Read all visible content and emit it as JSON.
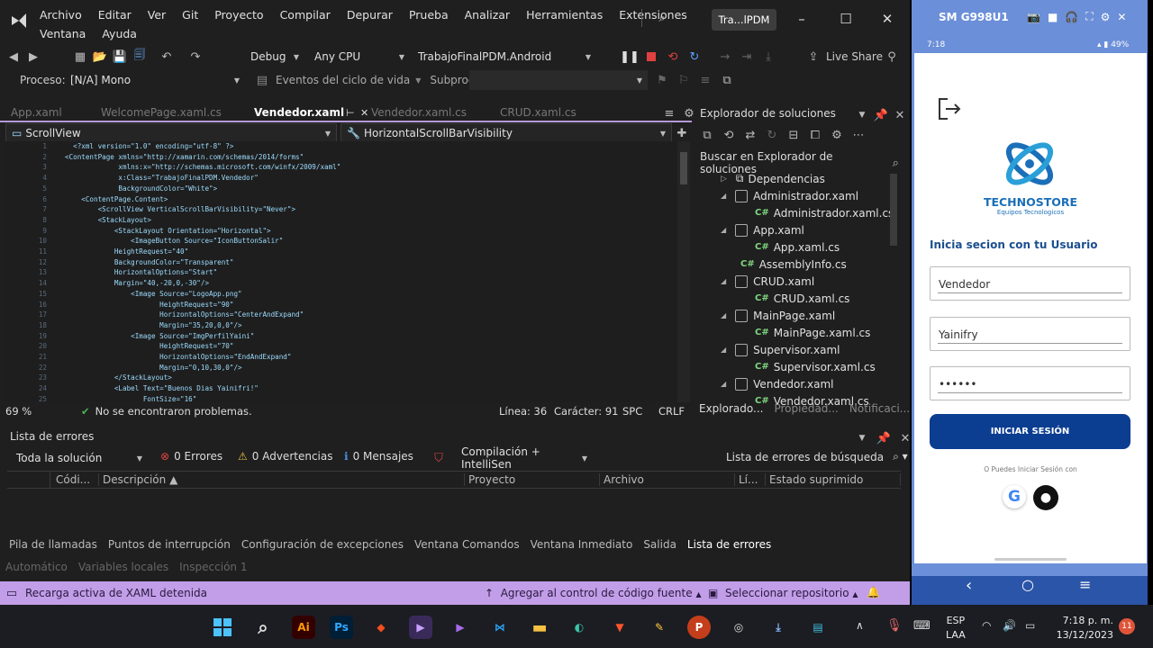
{
  "menu": [
    "Archivo",
    "Editar",
    "Ver",
    "Git",
    "Proyecto",
    "Compilar",
    "Depurar",
    "Prueba",
    "Analizar",
    "Herramientas",
    "Extensiones"
  ],
  "menu2": [
    "Ventana",
    "Ayuda"
  ],
  "window_title": "Tra...lPDM",
  "toolbar": {
    "config": "Debug",
    "platform": "Any CPU",
    "project": "TrabajoFinalPDM.Android",
    "live_share": "Live Share"
  },
  "process_bar": {
    "label": "Proceso:",
    "process": "[N/A] Mono",
    "lifecycle": "Eventos del ciclo de vida",
    "subprocess": "Subproceso:"
  },
  "doc_tabs": [
    "App.xaml",
    "WelcomePage.xaml.cs",
    "Vendedor.xaml",
    "Vendedor.xaml.cs",
    "CRUD.xaml.cs"
  ],
  "nav_left": "ScrollView",
  "nav_right": "HorizontalScrollBarVisibility",
  "code_lines": [
    "  <?xml version=\"1.0\" encoding=\"utf-8\" ?>",
    "<ContentPage xmlns=\"http://xamarin.com/schemas/2014/forms\"",
    "             xmlns:x=\"http://schemas.microsoft.com/winfx/2009/xaml\"",
    "             x:Class=\"TrabajoFinalPDM.Vendedor\"",
    "             BackgroundColor=\"White\">",
    "    <ContentPage.Content>",
    "        <ScrollView VerticalScrollBarVisibility=\"Never\">",
    "        <StackLayout>",
    "            <StackLayout Orientation=\"Horizontal\">",
    "                <ImageButton Source=\"IconButtonSalir\"",
    "            HeightRequest=\"40\"",
    "            BackgroundColor=\"Transparent\"",
    "            HorizontalOptions=\"Start\"",
    "            Margin=\"40,-20,0,-30\"/>",
    "                <Image Source=\"LogoApp.png\"",
    "                       HeightRequest=\"90\"",
    "                       HorizontalOptions=\"CenterAndExpand\"",
    "                       Margin=\"35,20,0,0\"/>",
    "                <Image Source=\"ImgPerfilYaini\"",
    "                       HeightRequest=\"70\"",
    "                       HorizontalOptions=\"EndAndExpand\"",
    "                       Margin=\"0,10,30,0\"/>",
    "            </StackLayout>",
    "            <Label Text=\"Buenos Dias Yainifri!\"",
    "                   FontSize=\"16\""
  ],
  "line_numbers": [
    "1",
    "2",
    "3",
    "4",
    "5",
    "6",
    "7",
    "8",
    "9",
    "10",
    "11",
    "12",
    "13",
    "14",
    "15",
    "16",
    "17",
    "18",
    "19",
    "20",
    "21",
    "22",
    "23",
    "24",
    "25"
  ],
  "editor_status": {
    "zoom": "69 %",
    "problems": "No se encontraron problemas.",
    "line": "Línea: 36",
    "char": "Carácter: 91",
    "spc": "SPC",
    "crlf": "CRLF"
  },
  "solution_explorer": {
    "title": "Explorador de soluciones",
    "search": "Buscar en Explorador de soluciones",
    "items": [
      {
        "label": "Dependencias",
        "kind": "dep"
      },
      {
        "label": "Administrador.xaml",
        "kind": "xaml"
      },
      {
        "label": "Administrador.xaml.cs",
        "kind": "cs"
      },
      {
        "label": "App.xaml",
        "kind": "xaml"
      },
      {
        "label": "App.xaml.cs",
        "kind": "cs"
      },
      {
        "label": "AssemblyInfo.cs",
        "kind": "cs0"
      },
      {
        "label": "CRUD.xaml",
        "kind": "xaml"
      },
      {
        "label": "CRUD.xaml.cs",
        "kind": "cs"
      },
      {
        "label": "MainPage.xaml",
        "kind": "xaml"
      },
      {
        "label": "MainPage.xaml.cs",
        "kind": "cs"
      },
      {
        "label": "Supervisor.xaml",
        "kind": "xaml"
      },
      {
        "label": "Supervisor.xaml.cs",
        "kind": "cs"
      },
      {
        "label": "Vendedor.xaml",
        "kind": "xaml"
      },
      {
        "label": "Vendedor.xaml.cs",
        "kind": "cs"
      }
    ],
    "tabs": [
      "Explorado...",
      "Propiedad...",
      "Notificaci..."
    ]
  },
  "errors": {
    "title": "Lista de errores",
    "scope": "Toda la solución",
    "errors": "0 Errores",
    "warnings": "0 Advertencias",
    "messages": "0 Mensajes",
    "build": "Compilación + IntelliSen",
    "search": "Lista de errores de búsqueda",
    "columns": [
      "Códi...",
      "Descripción",
      "Proyecto",
      "Archivo",
      "Lí...",
      "Estado suprimido"
    ]
  },
  "bottom_tabs": [
    "Pila de llamadas",
    "Puntos de interrupción",
    "Configuración de excepciones",
    "Ventana Comandos",
    "Ventana Inmediato",
    "Salida",
    "Lista de errores"
  ],
  "bottom_tabs2": [
    "Automático",
    "Variables locales",
    "Inspección 1"
  ],
  "status": {
    "left": "Recarga activa de XAML detenida",
    "source": "Agregar al control de código fuente",
    "repo": "Seleccionar repositorio"
  },
  "phone": {
    "device": "SM G998U1",
    "time": "7:18",
    "battery": "49%",
    "brand": "TECHNOSTORE",
    "tagline": "Equipos Tecnologicos",
    "heading": "Inicia secion con tu Usuario",
    "role": "Vendedor",
    "user": "Yainifry",
    "password": "••••••",
    "login": "INICIAR SESIÓN",
    "alt": "O Puedes Iniciar Sesión con"
  },
  "tray": {
    "lang1": "ESP",
    "lang2": "LAA",
    "time": "7:18 p. m.",
    "date": "13/12/2023",
    "badge": "11"
  },
  "colors": {
    "vs_bg": "#1f1f1f",
    "status": "#c29ee8",
    "accent": "#0b3d91",
    "brand": "#1b6fb8"
  }
}
